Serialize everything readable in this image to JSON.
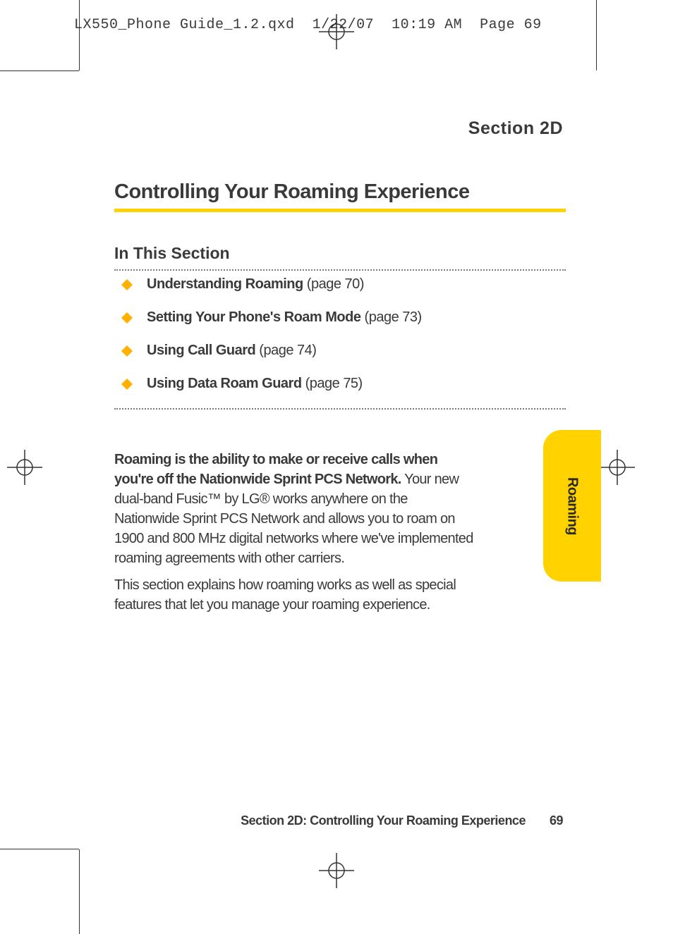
{
  "header": {
    "filename": "LX550_Phone Guide_1.2.qxd",
    "date": "1/22/07",
    "time": "10:19 AM",
    "page_label": "Page 69"
  },
  "section_label": "Section 2D",
  "title": "Controlling Your Roaming Experience",
  "in_this_section": "In This Section",
  "toc": [
    {
      "bold": "Understanding Roaming",
      "rest": " (page 70)"
    },
    {
      "bold": "Setting Your Phone's Roam Mode",
      "rest": " (page 73)"
    },
    {
      "bold": "Using Call Guard",
      "rest": " (page 74)"
    },
    {
      "bold": "Using Data Roam Guard",
      "rest": " (page 75)"
    }
  ],
  "body": {
    "p1_bold": "Roaming is the ability to make or receive calls when you're off the Nationwide Sprint PCS Network.",
    "p1_rest": " Your new dual-band Fusic™ by LG® works anywhere on the Nationwide Sprint PCS Network and allows you to roam on 1900 and 800 MHz digital networks where we've implemented roaming agreements with other carriers.",
    "p2": "This section explains how roaming works as well as special features that let you manage your roaming experience."
  },
  "tab": "Roaming",
  "footer": {
    "label": "Section 2D: Controlling Your Roaming Experience",
    "page": "69"
  }
}
